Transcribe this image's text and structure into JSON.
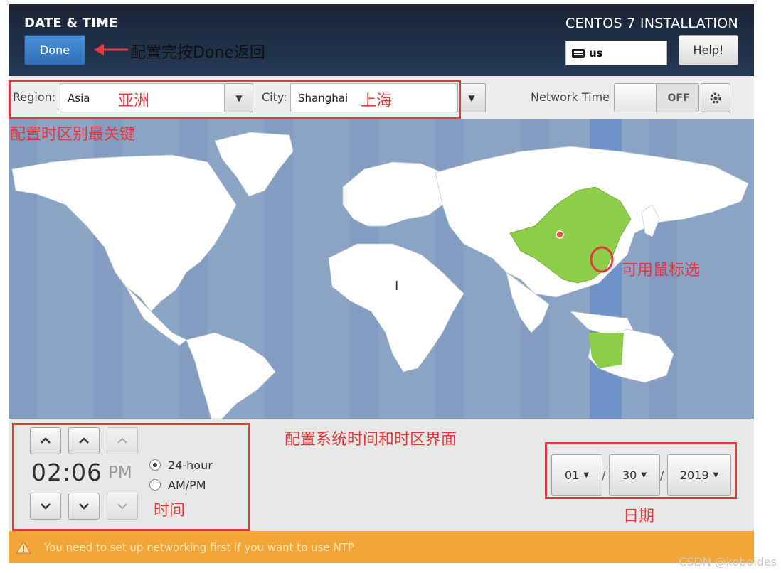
{
  "header": {
    "title": "DATE & TIME",
    "product": "CENTOS 7 INSTALLATION",
    "done_label": "Done",
    "keyboard_layout": "us",
    "help_label": "Help!"
  },
  "toolbar": {
    "region_label": "Region:",
    "region_value": "Asia",
    "city_label": "City:",
    "city_value": "Shanghai",
    "network_time_label": "Network Time",
    "network_time_state": "OFF"
  },
  "time": {
    "hours": "02",
    "separator": ":",
    "minutes": "06",
    "ampm": "PM",
    "format_24_label": "24-hour",
    "format_ampm_label": "AM/PM",
    "selected_format": "24-hour"
  },
  "date": {
    "month": "01",
    "day": "30",
    "year": "2019",
    "separator": "/"
  },
  "warning": {
    "text": "You need to set up networking first if you want to use NTP"
  },
  "annotations": {
    "done_note": "配置完按Done返回",
    "region_note": "亚洲",
    "city_note": "上海",
    "timezone_note": "配置时区别最关键",
    "mouse_note": "可用鼠标选",
    "screen_note": "配置系统时间和时区界面",
    "time_note": "时间",
    "date_note": "日期"
  },
  "watermark": "CSDN @koboides",
  "colors": {
    "header_bg": "#1f2d42",
    "done_blue": "#3b7fc9",
    "map_water": "#8aa4c6",
    "selected_timezone": "#6f93c9",
    "selected_region": "#8ccd4a",
    "warning_orange": "#f2a637",
    "annotation_red": "#e8383d"
  }
}
